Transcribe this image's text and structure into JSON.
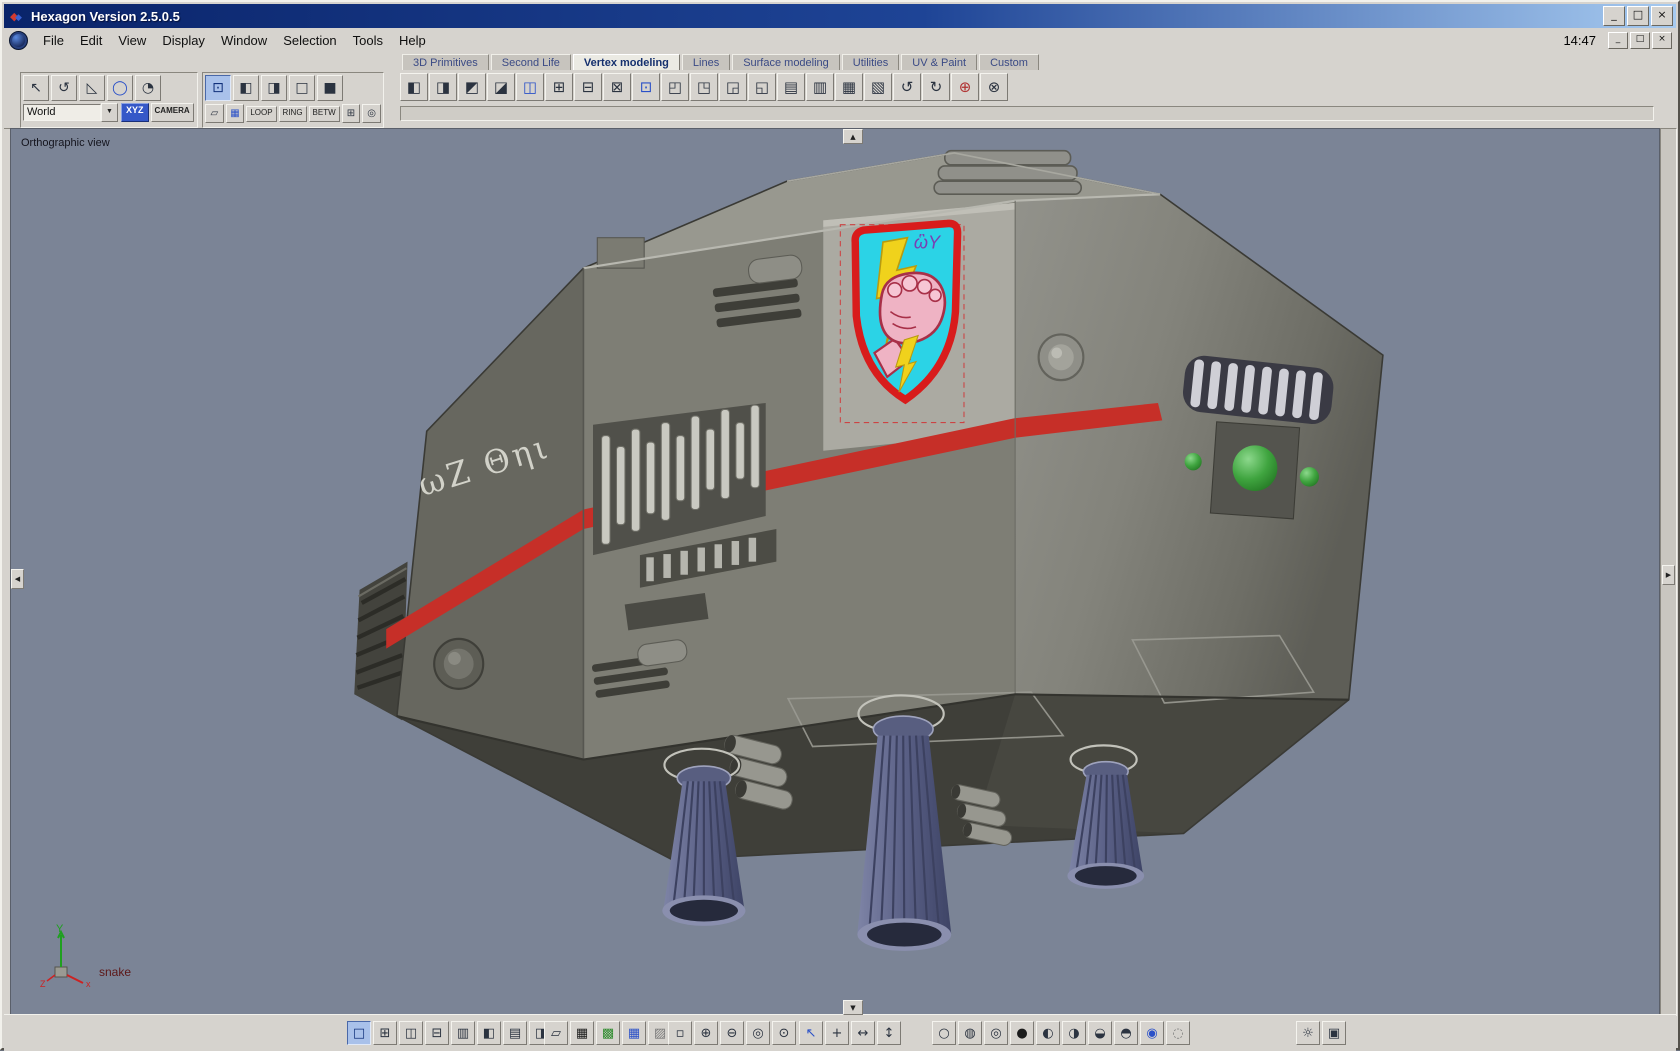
{
  "window": {
    "title": "Hexagon Version 2.5.0.5",
    "time": "14:47"
  },
  "titlebar_buttons": {
    "minimize": "_",
    "maximize": "□",
    "close": "×"
  },
  "menu": {
    "items": [
      "File",
      "Edit",
      "View",
      "Display",
      "Window",
      "Selection",
      "Tools",
      "Help"
    ]
  },
  "tabs": {
    "labels": [
      "3D Primitives",
      "Second Life",
      "Vertex modeling",
      "Lines",
      "Surface modeling",
      "Utilities",
      "UV & Paint",
      "Custom"
    ],
    "active": "Vertex modeling"
  },
  "left_toolbox": {
    "world": "World",
    "xyz": "XYZ",
    "camera": "CAMERA",
    "dropdown_arrow": "▼",
    "tools": {
      "select": "↖",
      "rotate": "↺",
      "measure": "◺",
      "ellipse": "◯",
      "lamp": "◔"
    }
  },
  "selection_toolbox": {
    "modes": {
      "points": "⊡",
      "edges": "◧",
      "faces": "◨",
      "objects": "□",
      "all": "■"
    },
    "loop": "LOOP",
    "ring": "RING",
    "betw": "BETW",
    "extras": {
      "paint": "▱",
      "grid": "▦",
      "plus": "⊞",
      "target": "◎"
    }
  },
  "vertex_tools": {
    "stretch": "◧",
    "scale": "◨",
    "extrude_face": "◩",
    "extrude_edge": "◪",
    "sweep": "◫",
    "tessellate": "⊞",
    "dissolve": "⊟",
    "cut": "⊠",
    "connect": "⊡",
    "weld": "◰",
    "bridge": "◳",
    "close_hole": "◲",
    "mirror": "◱",
    "thickness": "▤",
    "smooth": "▥",
    "decimate": "▦",
    "triangulate": "▧",
    "undo_tool": "↺",
    "redo_tool": "↻",
    "add_points": "⊕",
    "magnet": "⊗"
  },
  "viewport": {
    "view_label": "Orthographic view",
    "object_name": "snake",
    "hull_marking": "ωZ Θηι",
    "emblem_glyphs": "ὣΥ",
    "axis": {
      "x": "x",
      "y": "Y",
      "z": "Z"
    }
  },
  "bottom_toolbar": {
    "layout": {
      "single": "□",
      "quad": "⊞",
      "split_v": "◫",
      "split_h": "⊟",
      "three": "▥",
      "left": "◧",
      "rows": "▤",
      "right": "◨"
    },
    "display": {
      "draw": "▱",
      "wire": "▦",
      "grid_green": "▩",
      "grid_blue": "▦",
      "shaded_grid": "▨"
    },
    "navigate": {
      "marquee": "▫",
      "zoom_in": "⊕",
      "zoom_out": "⊖",
      "magnifier": "◎",
      "look": "⊙"
    },
    "manipulate": {
      "cursor": "↖",
      "axes": "+",
      "pan_h": "↔",
      "pan_v": "↕"
    },
    "shading": {
      "wire_sphere": "○",
      "seg_sphere": "◍",
      "ring_sphere": "◎",
      "flat_sphere": "●",
      "half_left": "◐",
      "half_right": "◑",
      "half_bottom": "◒",
      "half_top": "◓",
      "solid_sphere": "◉",
      "ghost_sphere": "◌"
    },
    "render": {
      "light": "☼",
      "snapshot": "▣"
    }
  },
  "scrollbars": {
    "up": "▲",
    "down": "▼",
    "left": "◀",
    "right": "▶"
  },
  "colors": {
    "stripe": "#c62f28",
    "emblem_cyan": "#2bd3e6",
    "emblem_red": "#d81c1c",
    "engine_blue": "#5a6086",
    "accent_green": "#3fa43f",
    "viewport_bg": "#7b8496",
    "titlebar_blue": "#0a246a"
  }
}
